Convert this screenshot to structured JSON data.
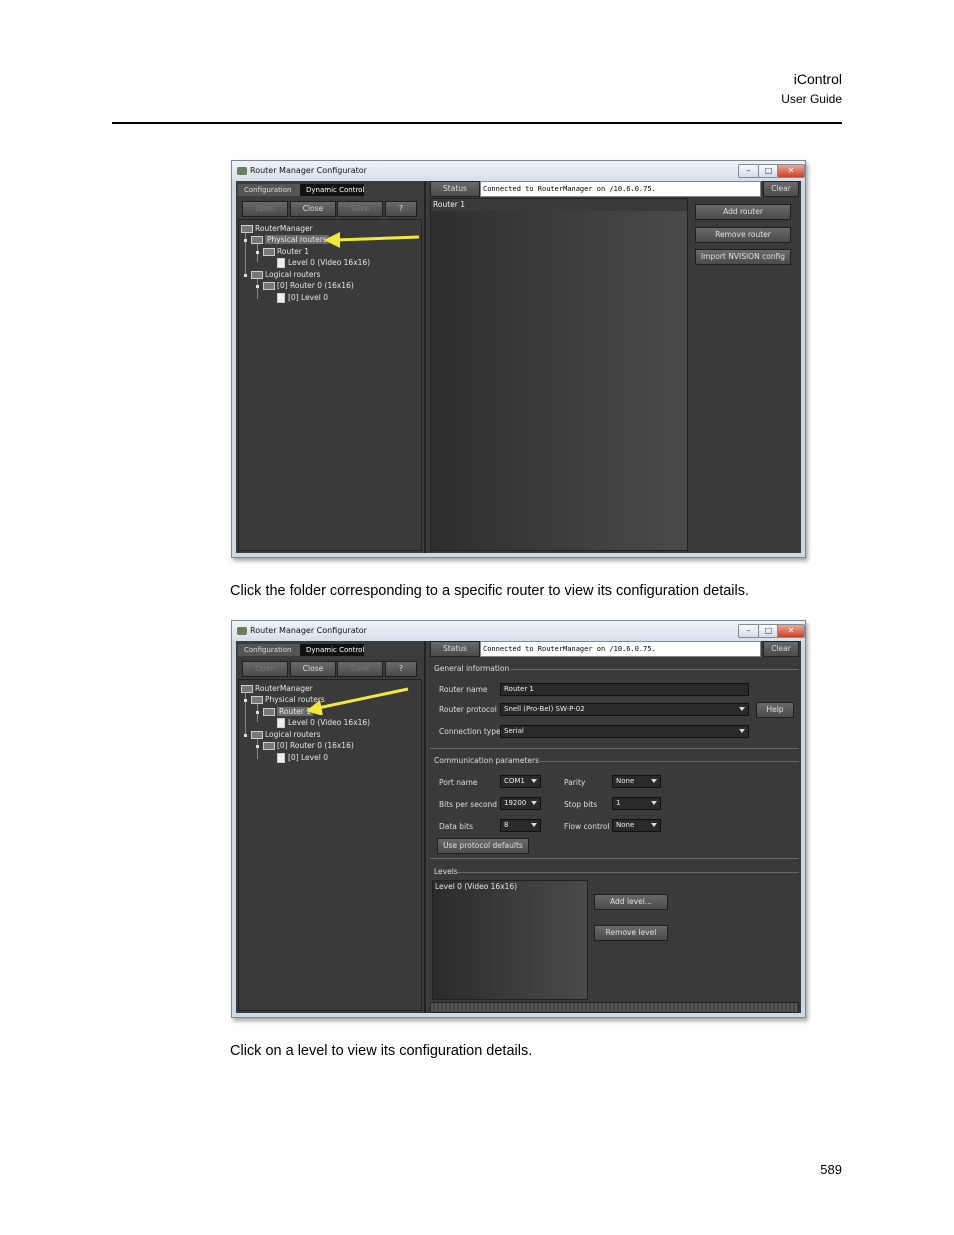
{
  "header": {
    "title": "iControl",
    "subtitle": "User Guide"
  },
  "captions": [
    "Click the folder corresponding to a specific router to view its configuration details.",
    "Click on a level to view its configuration details."
  ],
  "page_number": "589",
  "window": {
    "title": "Router Manager Configurator",
    "tabs": [
      "Configuration",
      "Dynamic Control"
    ],
    "toolbar": {
      "open": "Open",
      "close": "Close",
      "save": "Save",
      "help": "?"
    },
    "status_label": "Status",
    "status_text": "Connected to RouterManager on /10.6.0.75.",
    "clear_label": "Clear",
    "tree": {
      "root": "RouterManager",
      "physical": "Physical routers",
      "router1": "Router 1",
      "level0": "Level 0 (Video 16x16)",
      "logical": "Logical routers",
      "router0": "[0] Router 0 (16x16)",
      "level0b": "[0] Level 0"
    }
  },
  "screen1": {
    "list_header": "Router 1",
    "buttons": {
      "add": "Add router",
      "remove": "Remove router",
      "import": "Import NVISION config"
    }
  },
  "screen2": {
    "general": {
      "title": "General information",
      "router_name_label": "Router name",
      "router_name_value": "Router 1",
      "protocol_label": "Router protocol",
      "protocol_value": "Snell (Pro-Bel) SW-P-02",
      "help_label": "Help",
      "conn_label": "Connection type",
      "conn_value": "Serial"
    },
    "comm": {
      "title": "Communication parameters",
      "port_label": "Port name",
      "port_value": "COM1",
      "parity_label": "Parity",
      "parity_value": "None",
      "bps_label": "Bits per second",
      "bps_value": "19200",
      "stop_label": "Stop bits",
      "stop_value": "1",
      "data_label": "Data bits",
      "data_value": "8",
      "flow_label": "Flow control",
      "flow_value": "None",
      "defaults_label": "Use protocol defaults"
    },
    "levels": {
      "title": "Levels",
      "item": "Level 0 (Video 16x16)",
      "add": "Add level...",
      "remove": "Remove level"
    }
  },
  "colors": {
    "annotation_arrow": "#f2e83a"
  }
}
